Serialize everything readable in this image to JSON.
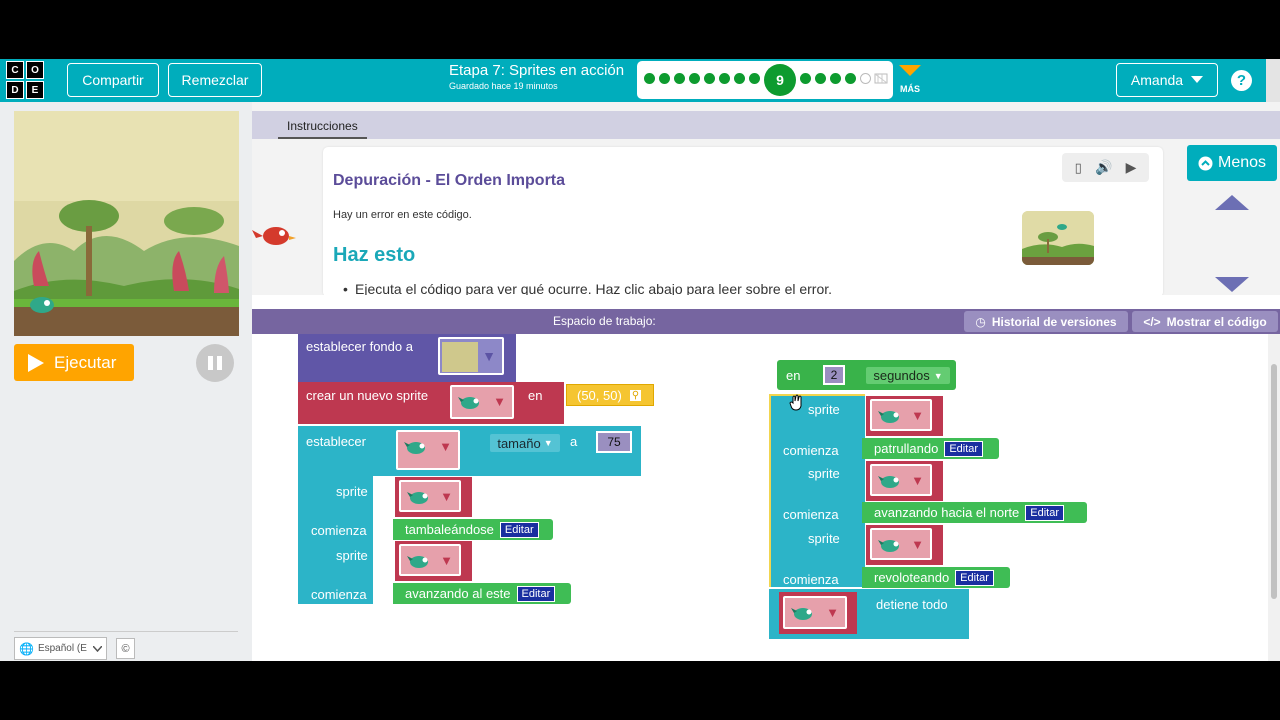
{
  "header": {
    "logo_letters": [
      "C",
      "O",
      "D",
      "E"
    ],
    "share_label": "Compartir",
    "remix_label": "Remezclar",
    "stage_title": "Etapa 7: Sprites en acción",
    "saved_text": "Guardado hace 19 minutos",
    "current_level": "9",
    "more_label": "MÁS",
    "user_label": "Amanda",
    "help_label": "?",
    "progress_color": "#0d9b2f",
    "accent_color": "#00adbc"
  },
  "left": {
    "run_label": "Ejecutar",
    "language_label": "Español (E",
    "copyright_label": "©"
  },
  "instructions": {
    "tab_label": "Instrucciones",
    "title": "Depuración - El Orden Importa",
    "text": "Hay un error en este código.",
    "do_this": "Haz esto",
    "bullet": "Ejecuta el código para ver qué ocurre. Haz clic abajo para leer sobre el error.",
    "less_label": "Menos"
  },
  "workspace": {
    "title": "Espacio de trabajo:",
    "history_label": "Historial de versiones",
    "show_code_label": "Mostrar el código",
    "left_stack": {
      "set_background": "establecer fondo a",
      "create_sprite": "crear un nuevo sprite",
      "at": "en",
      "position": "(50, 50)",
      "set": "establecer",
      "size_prop": "tamaño",
      "to": "a",
      "size_value": "75",
      "sprite": "sprite",
      "begins": "comienza",
      "behavior1": "tambaleándose",
      "behavior2": "avanzando al este",
      "edit": "Editar"
    },
    "right_stack": {
      "at": "en",
      "seconds_value": "2",
      "seconds_unit": "segundos",
      "sprite": "sprite",
      "begins": "comienza",
      "behavior1": "patrullando",
      "behavior2": "avanzando hacia el norte",
      "behavior3": "revoloteando",
      "stop_all": "detiene todo",
      "edit": "Editar"
    }
  }
}
